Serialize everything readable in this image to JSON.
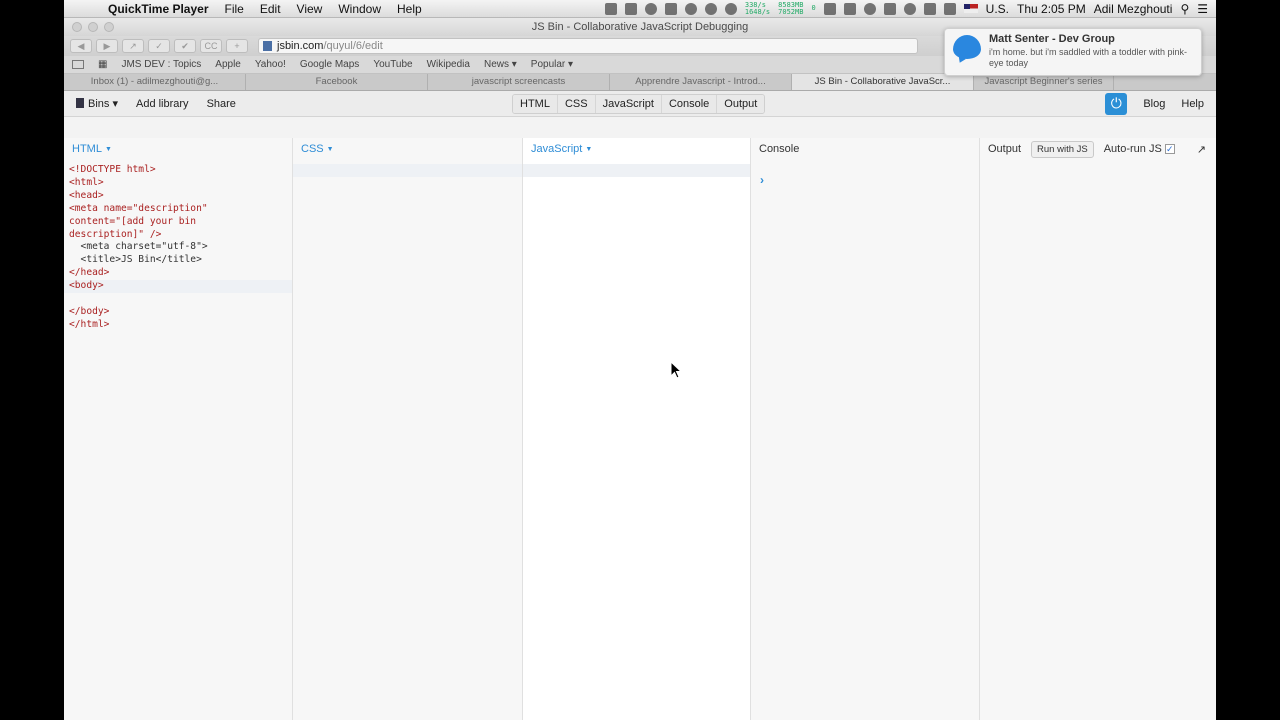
{
  "menubar": {
    "app": "QuickTime Player",
    "items": [
      "File",
      "Edit",
      "View",
      "Window",
      "Help"
    ],
    "net_stats": [
      "338/s",
      "1648/s"
    ],
    "mem_stats": [
      "8583MB",
      "7052MB"
    ],
    "mem_zero": "0",
    "locale": "U.S.",
    "clock": "Thu 2:05 PM",
    "user": "Adil Mezghouti"
  },
  "window": {
    "title": "JS Bin - Collaborative JavaScript Debugging"
  },
  "toolbar": {
    "cc": "CC",
    "url_host": "jsbin.com",
    "url_path": "/quyul/6/edit"
  },
  "bookmarks": [
    "JMS DEV : Topics",
    "Apple",
    "Yahoo!",
    "Google Maps",
    "YouTube",
    "Wikipedia",
    "News ▾",
    "Popular ▾"
  ],
  "tabs": [
    "Inbox (1) - adilmezghouti@g...",
    "Facebook",
    "javascript screencasts",
    "Apprendre Javascript - Introd...",
    "JS Bin - Collaborative JavaScr...",
    "Javascript Beginner's series"
  ],
  "jsbin": {
    "bins": "Bins",
    "add_library": "Add library",
    "share": "Share",
    "panels": [
      "HTML",
      "CSS",
      "JavaScript",
      "Console",
      "Output"
    ],
    "blog": "Blog",
    "help": "Help"
  },
  "html_panel": {
    "label": "HTML",
    "code": [
      "<!DOCTYPE html>",
      "<html>",
      "<head>",
      "<meta name=\"description\"",
      "content=\"[add your bin",
      "description]\" />",
      "  <meta charset=\"utf-8\">",
      "  <title>JS Bin</title>",
      "</head>",
      "<body>",
      "",
      "</body>",
      "</html>"
    ]
  },
  "css_panel": {
    "label": "CSS"
  },
  "js_panel": {
    "label": "JavaScript"
  },
  "console_panel": {
    "label": "Console",
    "prompt": "›"
  },
  "output_panel": {
    "label": "Output",
    "run_button": "Run with JS",
    "autorun": "Auto-run JS",
    "expand": "↗"
  },
  "notification": {
    "title": "Matt Senter - Dev Group",
    "body": "i'm home. but i'm saddled with a toddler with pink-eye today"
  },
  "colors": {
    "accent": "#2f8dd6",
    "tag": "#aa2222"
  }
}
